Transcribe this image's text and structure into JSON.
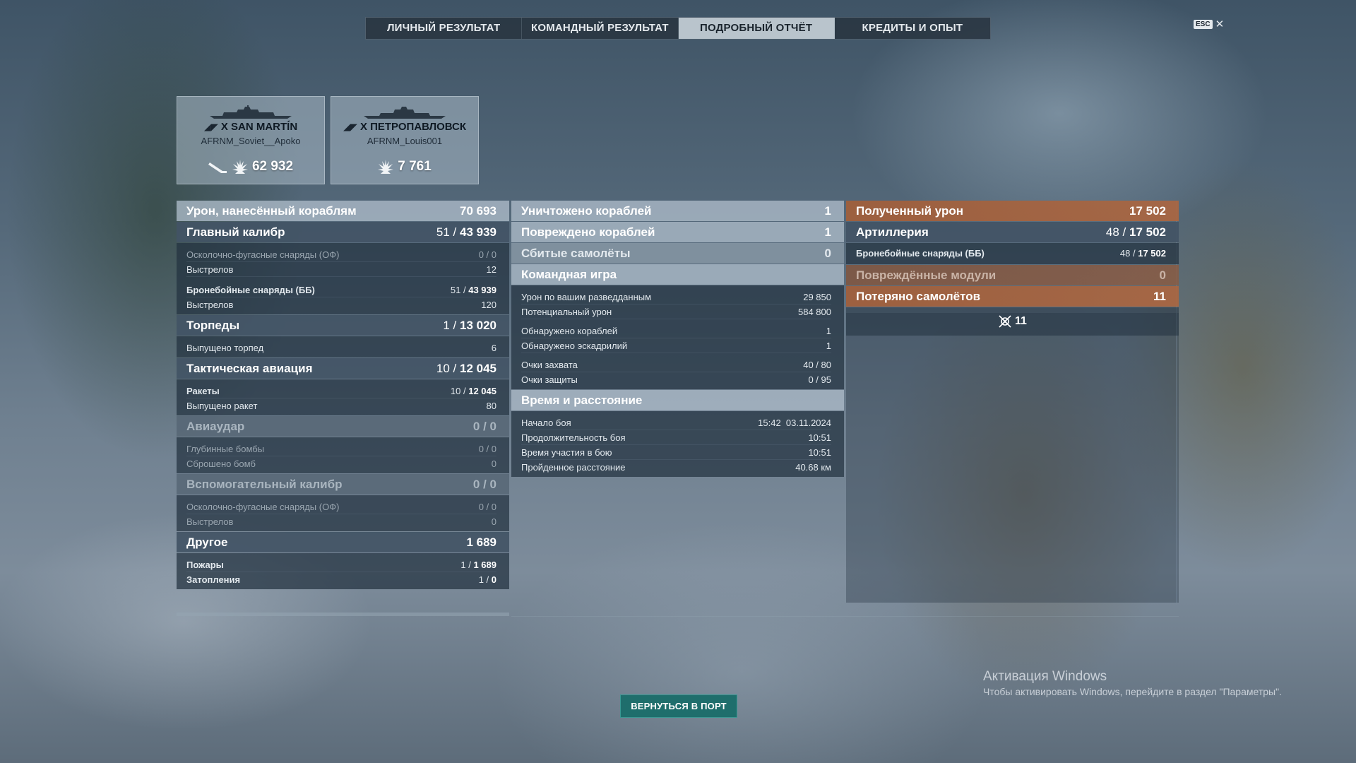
{
  "tabs": [
    {
      "label": "ЛИЧНЫЙ РЕЗУЛЬТАТ",
      "active": false
    },
    {
      "label": "КОМАНДНЫЙ РЕЗУЛЬТАТ",
      "active": false
    },
    {
      "label": "ПОДРОБНЫЙ ОТЧЁТ",
      "active": true
    },
    {
      "label": "КРЕДИТЫ И ОПЫТ",
      "active": false
    }
  ],
  "esc": {
    "key": "ESC",
    "close": "✕"
  },
  "cards": [
    {
      "ship": "X SAN MARTÍN",
      "player": "AFRNM_Soviet__Apoko",
      "score": "62 932"
    },
    {
      "ship": "X ПЕТРОПАВЛОВСК",
      "player": "AFRNM_Louis001",
      "score": "7 761"
    }
  ],
  "col1": {
    "damage": {
      "label": "Урон, нанесённый кораблям",
      "value": "70 693"
    },
    "main": {
      "label": "Главный калибр",
      "hits": "51",
      "value": "43 939"
    },
    "main_rows": [
      {
        "label": "Осколочно-фугасные снаряды (ОФ)",
        "value": "0 / 0"
      },
      {
        "label": "Выстрелов",
        "value": "12"
      },
      {
        "label": "Бронебойные снаряды (ББ)",
        "hits": "51",
        "value": "43 939"
      },
      {
        "label": "Выстрелов",
        "value": "120"
      }
    ],
    "torp": {
      "label": "Торпеды",
      "hits": "1",
      "value": "13 020"
    },
    "torp_rows": [
      {
        "label": "Выпущено торпед",
        "value": "6"
      }
    ],
    "air": {
      "label": "Тактическая авиация",
      "hits": "10",
      "value": "12 045"
    },
    "air_rows": [
      {
        "label": "Ракеты",
        "hits": "10",
        "value": "12 045"
      },
      {
        "label": "Выпущено ракет",
        "value": "80"
      }
    ],
    "strike": {
      "label": "Авиаудар",
      "value": "0 / 0"
    },
    "strike_rows": [
      {
        "label": "Глубинные бомбы",
        "value": "0 / 0"
      },
      {
        "label": "Сброшено бомб",
        "value": "0"
      }
    ],
    "sec": {
      "label": "Вспомогательный калибр",
      "value": "0 / 0"
    },
    "sec_rows": [
      {
        "label": "Осколочно-фугасные снаряды (ОФ)",
        "value": "0 / 0"
      },
      {
        "label": "Выстрелов",
        "value": "0"
      }
    ],
    "other": {
      "label": "Другое",
      "value": "1 689"
    },
    "other_rows": [
      {
        "label": "Пожары",
        "hits": "1",
        "value": "1 689"
      },
      {
        "label": "Затопления",
        "hits": "1",
        "value": "0"
      }
    ]
  },
  "col2": {
    "destroyed": {
      "label": "Уничтожено кораблей",
      "value": "1"
    },
    "damaged": {
      "label": "Повреждено кораблей",
      "value": "1"
    },
    "planes": {
      "label": "Сбитые самолёты",
      "value": "0"
    },
    "team": {
      "label": "Командная игра"
    },
    "team_rows": [
      {
        "label": "Урон по вашим разведданным",
        "value": "29 850"
      },
      {
        "label": "Потенциальный урон",
        "value": "584 800"
      },
      {
        "label": "Обнаружено кораблей",
        "value": "1"
      },
      {
        "label": "Обнаружено эскадрилий",
        "value": "1"
      },
      {
        "label": "Очки захвата",
        "value": "40 / 80"
      },
      {
        "label": "Очки защиты",
        "value": "0 / 95"
      }
    ],
    "time": {
      "label": "Время и расстояние"
    },
    "time_rows": [
      {
        "label": "Начало боя",
        "value": "15:42  03.11.2024"
      },
      {
        "label": "Продолжительность боя",
        "value": "10:51"
      },
      {
        "label": "Время участия в бою",
        "value": "10:51"
      },
      {
        "label": "Пройденное расстояние",
        "value": "40.68 км"
      }
    ]
  },
  "col3": {
    "received": {
      "label": "Полученный урон",
      "value": "17 502"
    },
    "artillery": {
      "label": "Артиллерия",
      "hits": "48",
      "value": "17 502"
    },
    "ap_row": {
      "label": "Бронебойные снаряды (ББ)",
      "hits": "48",
      "value": "17 502"
    },
    "modules": {
      "label": "Повреждённые модули",
      "value": "0"
    },
    "planes_lost": {
      "label": "Потеряно самолётов",
      "value": "11"
    },
    "planes_icon_count": "11"
  },
  "bottom": {
    "port_button": "ВЕРНУТЬСЯ В ПОРТ",
    "activation_title": "Активация Windows",
    "activation_text": "Чтобы активировать Windows, перейдите в раздел \"Параметры\"."
  }
}
